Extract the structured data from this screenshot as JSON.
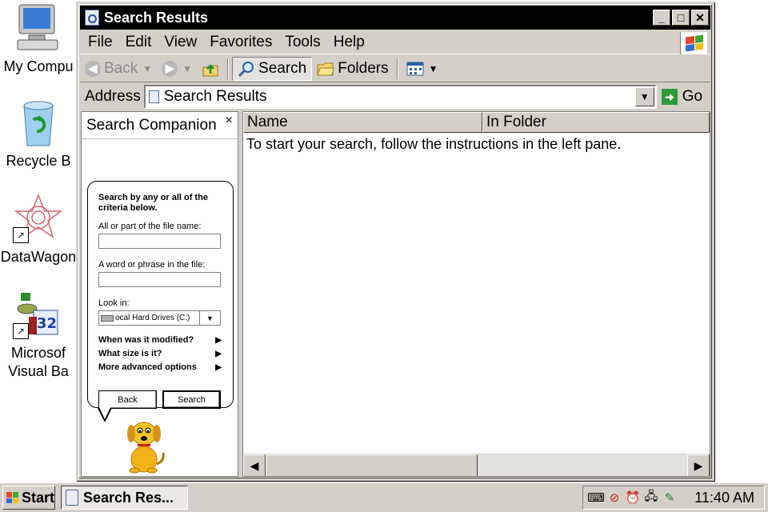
{
  "desktop": {
    "icons": [
      {
        "label": "My Compu",
        "icon": "my-computer-icon"
      },
      {
        "label": "Recycle B",
        "icon": "recycle-bin-icon"
      },
      {
        "label": "DataWagon",
        "icon": "datawagon-icon"
      },
      {
        "label": "Microsof\nVisual Ba",
        "icon": "visual-basic-icon"
      }
    ]
  },
  "window": {
    "title": "Search Results",
    "controls": {
      "minimize": "_",
      "maximize": "□",
      "close": "✕"
    },
    "menu": [
      "File",
      "Edit",
      "View",
      "Favorites",
      "Tools",
      "Help"
    ],
    "toolbar": {
      "back": "Back",
      "search": "Search",
      "folders": "Folders"
    },
    "address": {
      "label": "Address",
      "value": "Search Results",
      "go": "Go"
    }
  },
  "companion": {
    "title": "Search Companion",
    "close": "×",
    "intro": "Search by any or all of the criteria below.",
    "filename_label": "All or part of the file name:",
    "phrase_label": "A word or phrase in the file:",
    "lookin_label": "Look in:",
    "lookin_value": "ocal Hard Drives (C:)",
    "options": [
      "When was it modified?",
      "What size is it?",
      "More advanced options"
    ],
    "back_button": "Back",
    "search_button": "Search"
  },
  "results": {
    "columns": [
      "Name",
      "In Folder"
    ],
    "message": "To start your search, follow the instructions in the left pane."
  },
  "taskbar": {
    "start": "Start",
    "task": "Search Res...",
    "clock": "11:40 AM"
  },
  "colors": {
    "title_bar": "#000000",
    "face": "#d4d0c8",
    "go_green": "#2c9a3a"
  }
}
